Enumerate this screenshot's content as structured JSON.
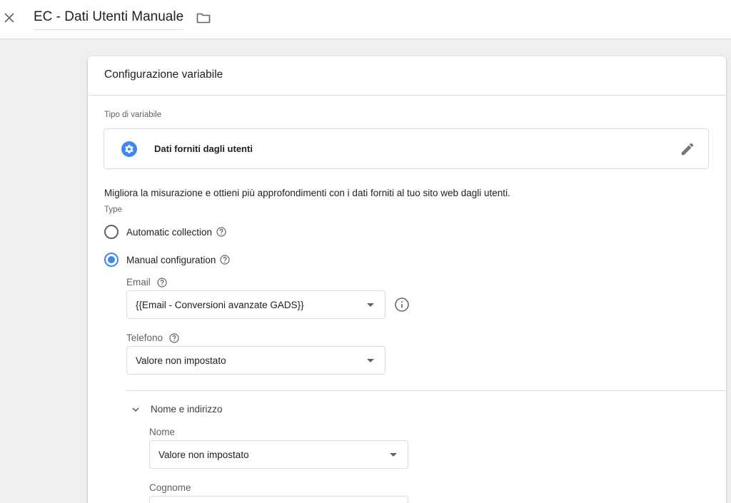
{
  "header": {
    "title": "EC - Dati Utenti Manuale",
    "close_icon": "close-icon",
    "folder_icon": "folder-icon"
  },
  "card": {
    "title": "Configurazione variabile",
    "variable_type_label": "Tipo di variabile",
    "variable_type": {
      "name": "Dati forniti dagli utenti",
      "icon": "settings-gear-icon",
      "icon_color": "#4285f4"
    },
    "description": "Migliora la misurazione e ottieni più approfondimenti con i dati forniti al tuo sito web dagli utenti.",
    "type_label": "Type",
    "options": [
      {
        "label": "Automatic collection",
        "checked": false
      },
      {
        "label": "Manual configuration",
        "checked": true
      }
    ],
    "fields": {
      "email": {
        "label": "Email",
        "value": "{{Email - Conversioni avanzate GADS}}"
      },
      "phone": {
        "label": "Telefono",
        "value": "Valore non impostato"
      }
    },
    "name_address": {
      "label": "Nome e indirizzo",
      "expanded": true,
      "first_name": {
        "label": "Nome",
        "value": "Valore non impostato"
      },
      "last_name": {
        "label": "Cognome",
        "value": ""
      }
    }
  },
  "colors": {
    "accent": "#4285f4",
    "background": "#efefef",
    "border": "#dadce0"
  }
}
